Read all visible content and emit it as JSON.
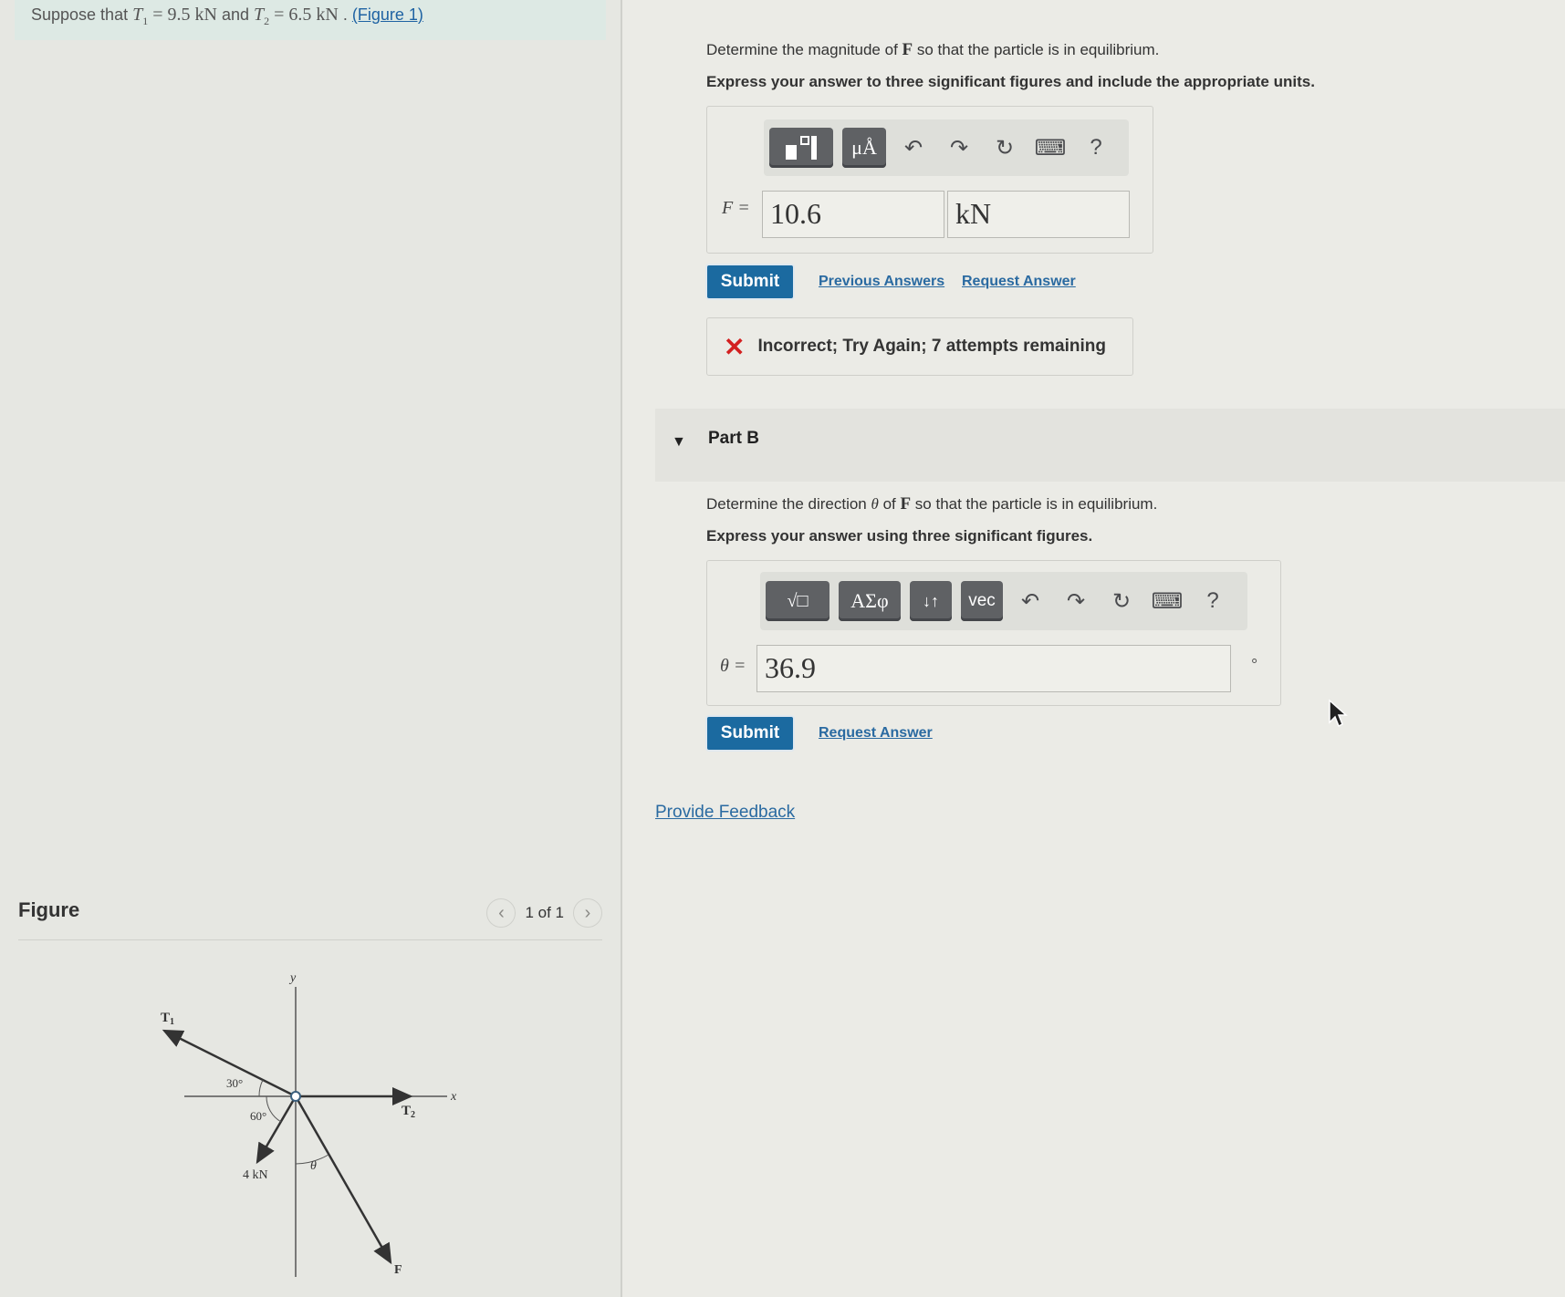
{
  "problem": {
    "prefix": "Suppose that",
    "t1_symbol": "T",
    "t1_sub": "1",
    "t1_value": " = 9.5  kN",
    "and_text": " and ",
    "t2_symbol": "T",
    "t2_sub": "2",
    "t2_value": " = 6.5  kN",
    "dot": " . ",
    "figure_link": "(Figure 1)"
  },
  "figure": {
    "title": "Figure",
    "pager_text": "1 of 1",
    "prev_glyph": "‹",
    "next_glyph": "›",
    "labels": {
      "y": "y",
      "x": "x",
      "t1": "T",
      "t1_sub": "1",
      "t2": "T",
      "t2_sub": "2",
      "angle30": "30°",
      "angle60": "60°",
      "force4": "4 kN",
      "theta": "θ",
      "f": "F"
    }
  },
  "part_a": {
    "instruction_pre": "Determine the magnitude of ",
    "instruction_bold": "F",
    "instruction_post": " so that the particle is in equilibrium.",
    "instruction2": "Express your answer to three significant figures and include the appropriate units.",
    "toolbar": {
      "units_btn": "μÅ",
      "undo": "↶",
      "redo": "↷",
      "reset": "↻",
      "keyboard": "⌨",
      "help": "?"
    },
    "field_label": "F =",
    "value": "10.6",
    "units": "kN",
    "submit": "Submit",
    "previous_answers": "Previous Answers",
    "request_answer": "Request Answer",
    "feedback": "Incorrect; Try Again; 7 attempts remaining",
    "feedback_icon": "✕"
  },
  "part_b": {
    "title": "Part B",
    "caret": "▼",
    "instruction_pre": "Determine the direction ",
    "instruction_theta": "θ",
    "instruction_mid": " of ",
    "instruction_bold": "F",
    "instruction_post": " so that the particle is in equilibrium.",
    "instruction2": "Express your answer using three significant figures.",
    "toolbar": {
      "math_btn": "√□",
      "greek_btn": "ΑΣφ",
      "arrows_btn": "↓↑",
      "vec_btn": "vec",
      "undo": "↶",
      "redo": "↷",
      "reset": "↻",
      "keyboard": "⌨",
      "help": "?"
    },
    "field_label": "θ =",
    "value": "36.9",
    "unit_symbol": "°",
    "submit": "Submit",
    "request_answer": "Request Answer"
  },
  "provide_feedback": "Provide Feedback",
  "colors": {
    "accent": "#1b6aa0",
    "link": "#2a6aa1",
    "error": "#d32020",
    "banner": "#dde9e4"
  }
}
